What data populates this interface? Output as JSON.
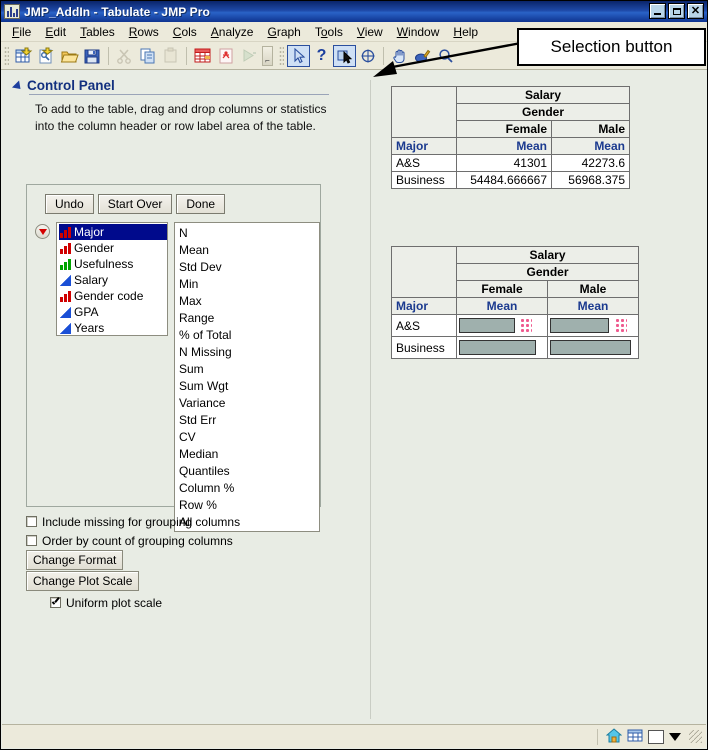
{
  "window": {
    "title": "JMP_AddIn - Tabulate - JMP Pro",
    "minimize_label": "Minimize",
    "maximize_label": "Maximize",
    "close_label": "Close"
  },
  "menu": {
    "items": [
      "File",
      "Edit",
      "Tables",
      "Rows",
      "Cols",
      "Analyze",
      "Graph",
      "Tools",
      "View",
      "Window",
      "Help"
    ]
  },
  "toolbar": {
    "group1": [
      {
        "name": "new-data-table-icon",
        "title": "New Data Table"
      },
      {
        "name": "new-script-icon",
        "title": "New Script"
      },
      {
        "name": "open-folder-icon",
        "title": "Open"
      },
      {
        "name": "save-icon",
        "title": "Save"
      }
    ],
    "group2": [
      {
        "name": "cut-scissors-icon",
        "title": "Cut"
      },
      {
        "name": "copy-icon",
        "title": "Copy"
      },
      {
        "name": "paste-icon",
        "title": "Paste"
      }
    ],
    "group3": [
      {
        "name": "data-table-icon",
        "title": "Data Table"
      },
      {
        "name": "report-icon",
        "title": "Report"
      },
      {
        "name": "run-script-icon",
        "title": "Run Script"
      }
    ],
    "group4": [
      {
        "name": "arrow-cursor-icon",
        "title": "Arrow"
      },
      {
        "name": "help-question-icon",
        "title": "Help"
      },
      {
        "name": "selection-icon",
        "title": "Selection"
      },
      {
        "name": "crosshair-icon",
        "title": "Crosshairs"
      },
      {
        "name": "hand-grabber-icon",
        "title": "Grabber"
      },
      {
        "name": "brush-icon",
        "title": "Brush"
      },
      {
        "name": "magnifier-icon",
        "title": "Magnifier"
      }
    ]
  },
  "callout": {
    "label": "Selection button"
  },
  "control_panel": {
    "title": "Control Panel",
    "instructions": "To add to the table, drag and drop columns or statistics into the column header or row label area of the table.",
    "buttons": {
      "undo": "Undo",
      "start_over": "Start Over",
      "done": "Done"
    },
    "columns": [
      {
        "label": "Major",
        "type": "nominal",
        "selected": true
      },
      {
        "label": "Gender",
        "type": "nominal",
        "selected": false
      },
      {
        "label": "Usefulness",
        "type": "ordinal",
        "selected": false
      },
      {
        "label": "Salary",
        "type": "continuous",
        "selected": false
      },
      {
        "label": "Gender code",
        "type": "nominal",
        "selected": false
      },
      {
        "label": "GPA",
        "type": "continuous",
        "selected": false
      },
      {
        "label": "Years",
        "type": "continuous",
        "selected": false
      }
    ],
    "statistics": [
      "N",
      "Mean",
      "Std Dev",
      "Min",
      "Max",
      "Range",
      "% of Total",
      "N Missing",
      "Sum",
      "Sum Wgt",
      "Variance",
      "Std Err",
      "CV",
      "Median",
      "Quantiles",
      "Column %",
      "Row %",
      "All"
    ],
    "options": [
      {
        "label": "Include missing for grouping columns",
        "checked": false
      },
      {
        "label": "Order by count of grouping columns",
        "checked": false
      }
    ],
    "change_format_label": "Change Format",
    "change_plot_scale_label": "Change Plot Scale",
    "uniform_plot_scale": {
      "label": "Uniform plot scale",
      "checked": true
    }
  },
  "tables": {
    "value_table": {
      "analysis_label": "Salary",
      "group_label": "Gender",
      "group_levels": [
        "Female",
        "Male"
      ],
      "row_header": "Major",
      "stat_headers": [
        "Mean",
        "Mean"
      ],
      "rows": [
        {
          "label": "A&S",
          "values": [
            "41301",
            "42273.6"
          ]
        },
        {
          "label": "Business",
          "values": [
            "54484.666667",
            "56968.375"
          ]
        }
      ]
    },
    "plot_table": {
      "analysis_label": "Salary",
      "group_label": "Gender",
      "group_levels": [
        "Female",
        "Male"
      ],
      "row_header": "Major",
      "stat_headers": [
        "Mean",
        "Mean"
      ],
      "rows": [
        {
          "label": "A&S",
          "bars": [
            66,
            69
          ]
        },
        {
          "label": "Business",
          "bars": [
            87,
            91
          ]
        }
      ]
    }
  },
  "status_bar": {
    "home_icon": "home-icon",
    "table_icon": "data-table-icon",
    "color_swatch": "white",
    "dropdown": "caret-down-icon",
    "resize_grip": "resize-grip"
  },
  "colors": {
    "title_bar": "#0a246a",
    "panel_bg": "#e8ece4",
    "toolbar_bg": "#eceadb",
    "heading_blue": "#12307f",
    "selection_blue": "#000a8c",
    "nominal_red": "#d00000",
    "ordinal_green": "#00a400",
    "continuous_blue": "#1a4fd6",
    "bar_fill": "#9fb0ad",
    "dot_pink": "#ef5a8e"
  }
}
